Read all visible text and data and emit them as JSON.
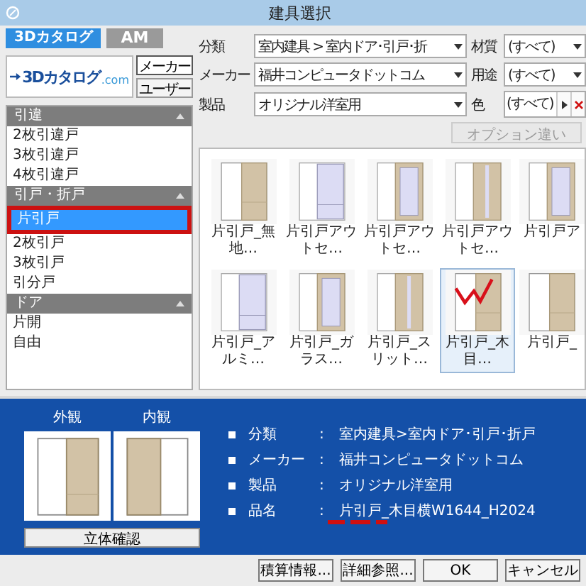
{
  "window": {
    "title": "建具選択"
  },
  "tabs": [
    {
      "label": "3Dカタログ",
      "selected": true
    },
    {
      "label": "AM",
      "selected": false
    }
  ],
  "logo": {
    "text": "3Dカタログ",
    "suffix": ".com"
  },
  "source_buttons": [
    {
      "label": "メーカー",
      "selected": true
    },
    {
      "label": "ユーザー",
      "selected": false
    }
  ],
  "filters": [
    {
      "label": "分類",
      "value": "室内建具 > 室内ドア･引戸･折",
      "kind": "dropdown"
    },
    {
      "label": "材質",
      "value": "(すべて)",
      "kind": "dropdown"
    },
    {
      "label": "メーカー",
      "value": "福井コンピュータドットコム",
      "kind": "dropdown"
    },
    {
      "label": "用途",
      "value": "(すべて)",
      "kind": "dropdown"
    },
    {
      "label": "製品",
      "value": "オリジナル洋室用",
      "kind": "dropdown"
    },
    {
      "label": "色",
      "value": "(すべて)",
      "kind": "picker"
    }
  ],
  "option_button": {
    "label": "オプション違い",
    "disabled": true
  },
  "categories": [
    {
      "label": "引違",
      "expanded": true,
      "items": [
        {
          "label": "2枚引違戸",
          "selected": false
        },
        {
          "label": "3枚引違戸",
          "selected": false
        },
        {
          "label": "4枚引違戸",
          "selected": false
        }
      ]
    },
    {
      "label": "引戸・折戸",
      "expanded": true,
      "items": [
        {
          "label": "片引戸",
          "selected": true
        },
        {
          "label": "2枚引戸",
          "selected": false
        },
        {
          "label": "3枚引戸",
          "selected": false
        },
        {
          "label": "引分戸",
          "selected": false
        }
      ]
    },
    {
      "label": "ドア",
      "expanded": true,
      "items": [
        {
          "label": "片開",
          "selected": false
        },
        {
          "label": "自由",
          "selected": false
        }
      ]
    }
  ],
  "products": [
    {
      "label": "片引戸_無地…",
      "kind": "wood",
      "selected": false
    },
    {
      "label": "片引戸アウトセ…",
      "kind": "frosted",
      "selected": false
    },
    {
      "label": "片引戸アウトセ…",
      "kind": "glass",
      "selected": false
    },
    {
      "label": "片引戸アウトセ…",
      "kind": "slit",
      "selected": false
    },
    {
      "label": "片引戸ア",
      "kind": "glass",
      "selected": false
    },
    {
      "label": "片引戸_アルミ…",
      "kind": "frosted",
      "selected": false
    },
    {
      "label": "片引戸_ガラス…",
      "kind": "glass",
      "selected": false
    },
    {
      "label": "片引戸_スリット…",
      "kind": "slit",
      "selected": false
    },
    {
      "label": "片引戸_木目…",
      "kind": "wood",
      "selected": true
    },
    {
      "label": "片引戸_",
      "kind": "wood",
      "selected": false
    }
  ],
  "preview": {
    "views": [
      {
        "label": "外観",
        "kind": "exterior"
      },
      {
        "label": "内観",
        "kind": "interior"
      }
    ],
    "button": "立体確認"
  },
  "details": [
    {
      "label": "分類",
      "value": "室内建具>室内ドア･引戸･折戸",
      "marked": false
    },
    {
      "label": "メーカー",
      "value": "福井コンピュータドットコム",
      "marked": false
    },
    {
      "label": "製品",
      "value": "オリジナル洋室用",
      "marked": false
    },
    {
      "label": "品名",
      "value": "片引戸_木目横W1644_H2024",
      "marked": true
    }
  ],
  "separator": ":",
  "buttons": [
    "積算情報...",
    "詳細参照...",
    "OK",
    "キャンセル"
  ]
}
